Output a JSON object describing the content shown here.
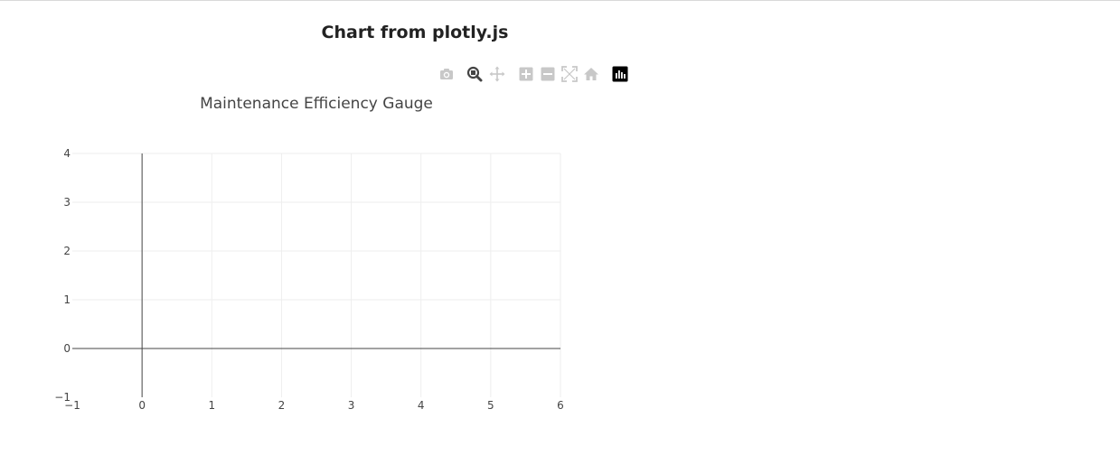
{
  "page": {
    "title": "Chart from plotly.js"
  },
  "modebar": {
    "buttons": [
      {
        "icon": "camera-icon",
        "label": "Download plot as a png",
        "active": false
      },
      {
        "icon": "zoom-icon",
        "label": "Zoom",
        "active": true
      },
      {
        "icon": "pan-icon",
        "label": "Pan",
        "active": false
      },
      {
        "icon": "zoom-in-icon",
        "label": "Zoom in",
        "active": false
      },
      {
        "icon": "zoom-out-icon",
        "label": "Zoom out",
        "active": false
      },
      {
        "icon": "autoscale-icon",
        "label": "Autoscale",
        "active": false
      },
      {
        "icon": "home-icon",
        "label": "Reset axes",
        "active": false
      },
      {
        "icon": "plotly-logo-icon",
        "label": "Produced with Plotly",
        "active": false
      }
    ],
    "colors": {
      "inactive": "#c8c8c8",
      "active": "#444444",
      "logo_bg": "#000000"
    }
  },
  "chart_data": {
    "type": "scatter",
    "title": "Maintenance Efficiency Gauge",
    "xlabel": "",
    "ylabel": "",
    "xlim": [
      -1,
      6
    ],
    "ylim": [
      -1,
      4
    ],
    "x_ticks": [
      -1,
      0,
      1,
      2,
      3,
      4,
      5,
      6
    ],
    "y_ticks": [
      -1,
      0,
      1,
      2,
      3,
      4
    ],
    "x_tick_labels": [
      "−1",
      "0",
      "1",
      "2",
      "3",
      "4",
      "5",
      "6"
    ],
    "y_tick_labels": [
      "−1",
      "0",
      "1",
      "2",
      "3",
      "4"
    ],
    "grid": true,
    "zeroline": true,
    "series": [],
    "colors": {
      "grid": "#eeeeee",
      "zeroline": "#444444",
      "text": "#444444"
    }
  }
}
